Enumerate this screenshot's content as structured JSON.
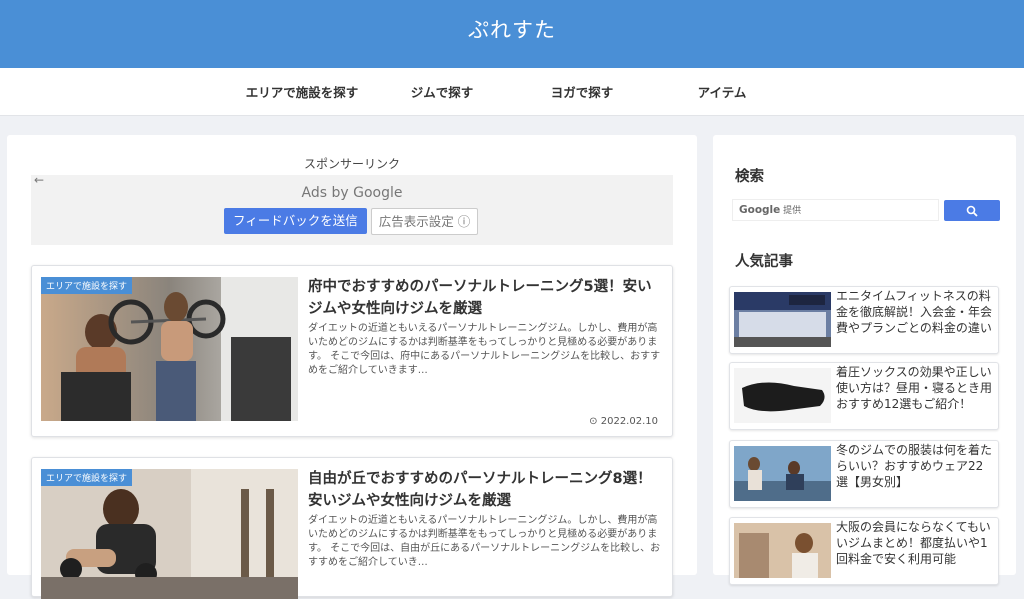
{
  "site": {
    "title": "ぷれすた"
  },
  "nav": {
    "items": [
      {
        "label": "エリアで施設を探す"
      },
      {
        "label": "ジムで探す"
      },
      {
        "label": "ヨガで探す"
      },
      {
        "label": "アイテム"
      }
    ]
  },
  "ad": {
    "sponsor_label": "スポンサーリンク",
    "back_icon": "←",
    "ads_by": "Ads by Google",
    "feedback_label": "フィードバックを送信",
    "settings_label": "広告表示設定",
    "info_icon": "ⓘ"
  },
  "articles": [
    {
      "category": "エリアで施設を探す",
      "title": "府中でおすすめのパーソナルトレーニング5選！安いジムや女性向けジムを厳選",
      "excerpt": "ダイエットの近道ともいえるパーソナルトレーニングジム。しかし、費用が高いためどのジムにするかは判断基準をもってしっかりと見極める必要があります。 そこで今回は、府中にあるパーソナルトレーニングジムを比較し、おすすめをご紹介していきます…",
      "date": "2022.02.10",
      "clock_icon": "⊙"
    },
    {
      "category": "エリアで施設を探す",
      "title": "自由が丘でおすすめのパーソナルトレーニング8選！安いジムや女性向けジムを厳選",
      "excerpt": "ダイエットの近道ともいえるパーソナルトレーニングジム。しかし、費用が高いためどのジムにするかは判断基準をもってしっかりと見極める必要があります。 そこで今回は、自由が丘にあるパーソナルトレーニングジムを比較し、おすすめをご紹介していき…"
    }
  ],
  "sidebar": {
    "search_heading": "検索",
    "search_google": "Google",
    "search_provided": "提供",
    "popular_heading": "人気記事",
    "popular": [
      {
        "title": "エニタイムフィットネスの料金を徹底解説！入会金・年会費やプランごとの料金の違い"
      },
      {
        "title": "着圧ソックスの効果や正しい使い方は？昼用・寝るとき用おすすめ12選もご紹介！"
      },
      {
        "title": "冬のジムでの服装は何を着たらいい？おすすめウェア22選【男女別】"
      },
      {
        "title": "大阪の会員にならなくてもいいジムまとめ！都度払いや1回料金で安く利用可能"
      }
    ]
  },
  "colors": {
    "header_bg": "#4a8fd6",
    "accent_button": "#4b7be5",
    "badge": "#4a8fd6"
  }
}
